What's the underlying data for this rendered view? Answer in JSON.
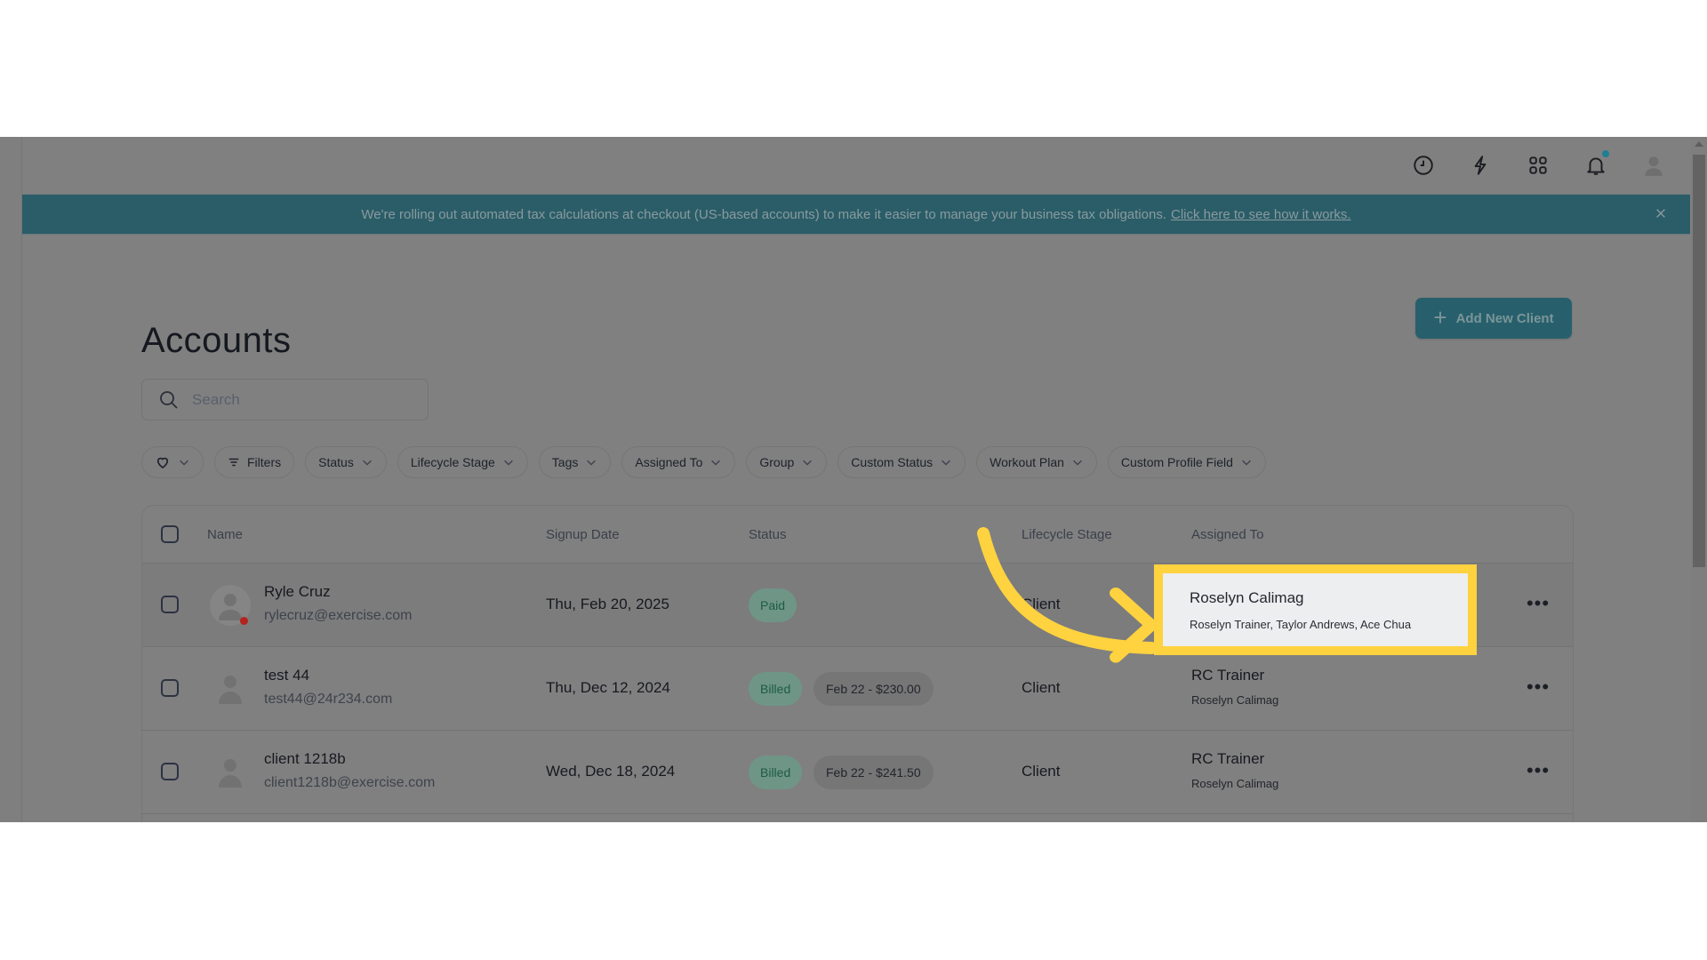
{
  "topbar": {
    "icons": [
      "clock-icon",
      "bolt-icon",
      "apps-grid-icon",
      "bell-icon",
      "user-avatar-icon"
    ],
    "notification_dot_color": "#1f7e93"
  },
  "banner": {
    "message": "We're rolling out automated tax calculations at checkout (US-based accounts) to make it easier to manage your business tax obligations.",
    "link_text": "Click here to see how it works.",
    "close_icon": "close-icon",
    "color": "#2a5d67"
  },
  "page": {
    "title": "Accounts",
    "add_button_label": "Add New Client",
    "accent_color": "#27606c"
  },
  "search": {
    "placeholder": "Search",
    "value": ""
  },
  "filters": {
    "favorites_icon": "heart-icon",
    "filters_label": "Filters",
    "chips": [
      "Status",
      "Lifecycle Stage",
      "Tags",
      "Assigned To",
      "Group",
      "Custom Status",
      "Workout Plan",
      "Custom Profile Field"
    ]
  },
  "table": {
    "columns": {
      "name": "Name",
      "signup_date": "Signup Date",
      "status": "Status",
      "lifecycle_stage": "Lifecycle Stage",
      "assigned_to": "Assigned To"
    },
    "rows": [
      {
        "name": "Ryle Cruz",
        "email": "rylecruz@exercise.com",
        "signup_date": "Thu, Feb 20, 2025",
        "status": "Paid",
        "invoice": "",
        "lifecycle_stage": "Client",
        "assigned_primary": "Roselyn Calimag",
        "assigned_secondary": "Roselyn Trainer, Taylor Andrews, Ace Chua",
        "online": true
      },
      {
        "name": "test 44",
        "email": "test44@24r234.com",
        "signup_date": "Thu, Dec 12, 2024",
        "status": "Billed",
        "invoice": "Feb 22 - $230.00",
        "lifecycle_stage": "Client",
        "assigned_primary": "RC Trainer",
        "assigned_secondary": "Roselyn Calimag",
        "online": false
      },
      {
        "name": "client 1218b",
        "email": "client1218b@exercise.com",
        "signup_date": "Wed, Dec 18, 2024",
        "status": "Billed",
        "invoice": "Feb 22 - $241.50",
        "lifecycle_stage": "Client",
        "assigned_primary": "RC Trainer",
        "assigned_secondary": "Roselyn Calimag",
        "online": false
      }
    ],
    "row_menu_icon": "more-horizontal-icon"
  },
  "annotation": {
    "highlight_color": "#ffd23f",
    "arrow_icon": "curved-arrow-icon",
    "highlighted_primary": "Roselyn Calimag",
    "highlighted_secondary": "Roselyn Trainer, Taylor Andrews, Ace Chua"
  }
}
